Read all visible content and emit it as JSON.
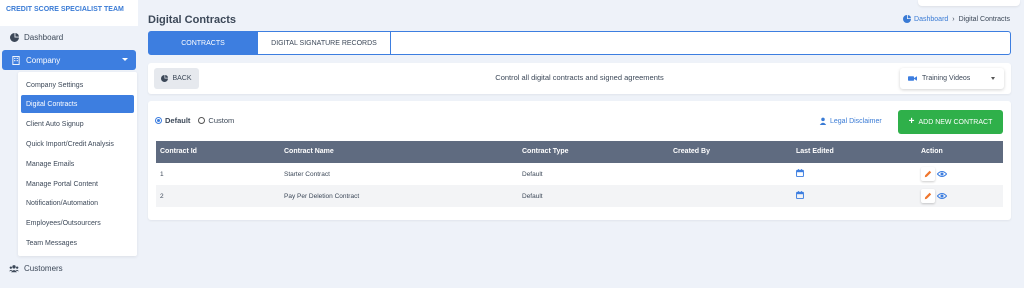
{
  "brand": "CREDIT SCORE SPECIALIST TEAM",
  "sidebar": {
    "dashboard": "Dashboard",
    "company": "Company",
    "submenu": [
      "Company Settings",
      "Digital Contracts",
      "Client Auto Signup",
      "Quick Import/Credit Analysis",
      "Manage Emails",
      "Manage Portal Content",
      "Notification/Automation",
      "Employees/Outsourcers",
      "Team Messages"
    ],
    "customers": "Customers"
  },
  "page": {
    "title": "Digital Contracts",
    "breadcrumb_root": "Dashboard",
    "breadcrumb_sep": "›",
    "breadcrumb_current": "Digital Contracts"
  },
  "tabs": [
    "CONTRACTS",
    "DIGITAL SIGNATURE RECORDS"
  ],
  "toolbar": {
    "back": "BACK",
    "message": "Control all digital contracts and signed agreements",
    "training": "Training Videos"
  },
  "filters": {
    "default": "Default",
    "custom": "Custom",
    "legal": "Legal Disclaimer",
    "add": "ADD NEW CONTRACT"
  },
  "table": {
    "headers": [
      "Contract Id",
      "Contract Name",
      "Contract Type",
      "Created By",
      "Last Edited",
      "Action"
    ],
    "rows": [
      [
        "1",
        "Starter Contract",
        "Default",
        ""
      ],
      [
        "2",
        "Pay Per Deletion Contract",
        "Default",
        ""
      ]
    ]
  },
  "colors": {
    "primary": "#3d7ee0",
    "success": "#2fb04a",
    "table_header": "#5f6b80",
    "edit": "#f0762d"
  }
}
